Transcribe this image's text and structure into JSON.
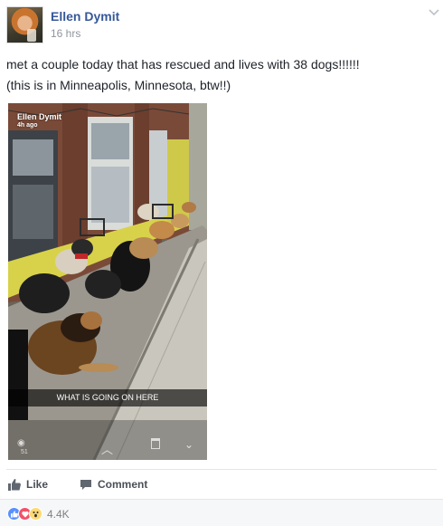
{
  "post": {
    "author": "Ellen Dymit",
    "time": "16 hrs",
    "text_line1": "met a couple today that has rescued and lives with 38 dogs!!!!!!",
    "text_line2": "(this is in Minneapolis, Minnesota, btw!!)"
  },
  "photo": {
    "snap_name": "Ellen Dymit",
    "snap_ago": "4h ago",
    "caption": "WHAT IS GOING ON HERE",
    "view_count": "51"
  },
  "actions": {
    "like_label": "Like",
    "comment_label": "Comment"
  },
  "reactions": {
    "types": [
      "like-icon",
      "love-icon",
      "wow-icon"
    ],
    "count": "4.4K"
  },
  "colors": {
    "author_link": "#365899",
    "like_blue": "#5890ff",
    "love_red": "#f25268",
    "wow_yellow": "#ffd972"
  }
}
